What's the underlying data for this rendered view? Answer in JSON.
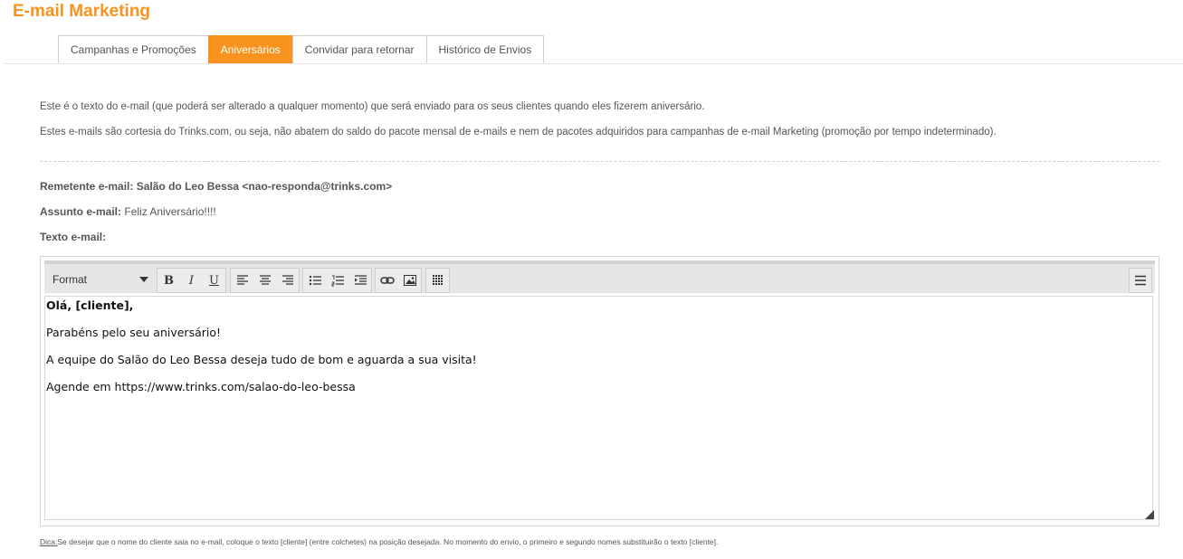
{
  "page": {
    "title": "E-mail Marketing"
  },
  "tabs": [
    {
      "label": "Campanhas e Promoções",
      "active": false
    },
    {
      "label": "Aniversários",
      "active": true
    },
    {
      "label": "Convidar para retornar",
      "active": false
    },
    {
      "label": "Histórico de Envios",
      "active": false
    }
  ],
  "intro": {
    "line1": "Este é o texto do e-mail (que poderá ser alterado a qualquer momento) que será enviado para os seus clientes quando eles fizerem aniversário.",
    "line2": "Estes e-mails são cortesia do Trinks.com, ou seja, não abatem do saldo do pacote mensal de e-mails e nem de pacotes adquiridos para campanhas de e-mail Marketing (promoção por tempo indeterminado)."
  },
  "fields": {
    "sender_label": "Remetente e-mail:",
    "sender_value": "Salão do Leo Bessa <nao-responda@trinks.com>",
    "subject_label": "Assunto e-mail:",
    "subject_value": "Feliz Aniversário!!!!",
    "body_label": "Texto e-mail:"
  },
  "toolbar": {
    "format_label": "Format",
    "bold": "B",
    "italic": "I",
    "underline": "U"
  },
  "editor": {
    "greeting": "Olá, [cliente],",
    "line1": "Parabéns pelo seu aniversário!",
    "line2": "A equipe do Salão do Leo Bessa deseja tudo de bom e aguarda a sua visita!",
    "line3": "Agende em https://www.trinks.com/salao-do-leo-bessa"
  },
  "tip": {
    "label": "Dica:",
    "text": "Se desejar que o nome do cliente saia no e-mail, coloque o texto [cliente] (entre colchetes) na posição desejada. No momento do envio, o primeiro e segundo nomes substituirão o texto [cliente]."
  },
  "colors": {
    "accent": "#f7931e"
  }
}
